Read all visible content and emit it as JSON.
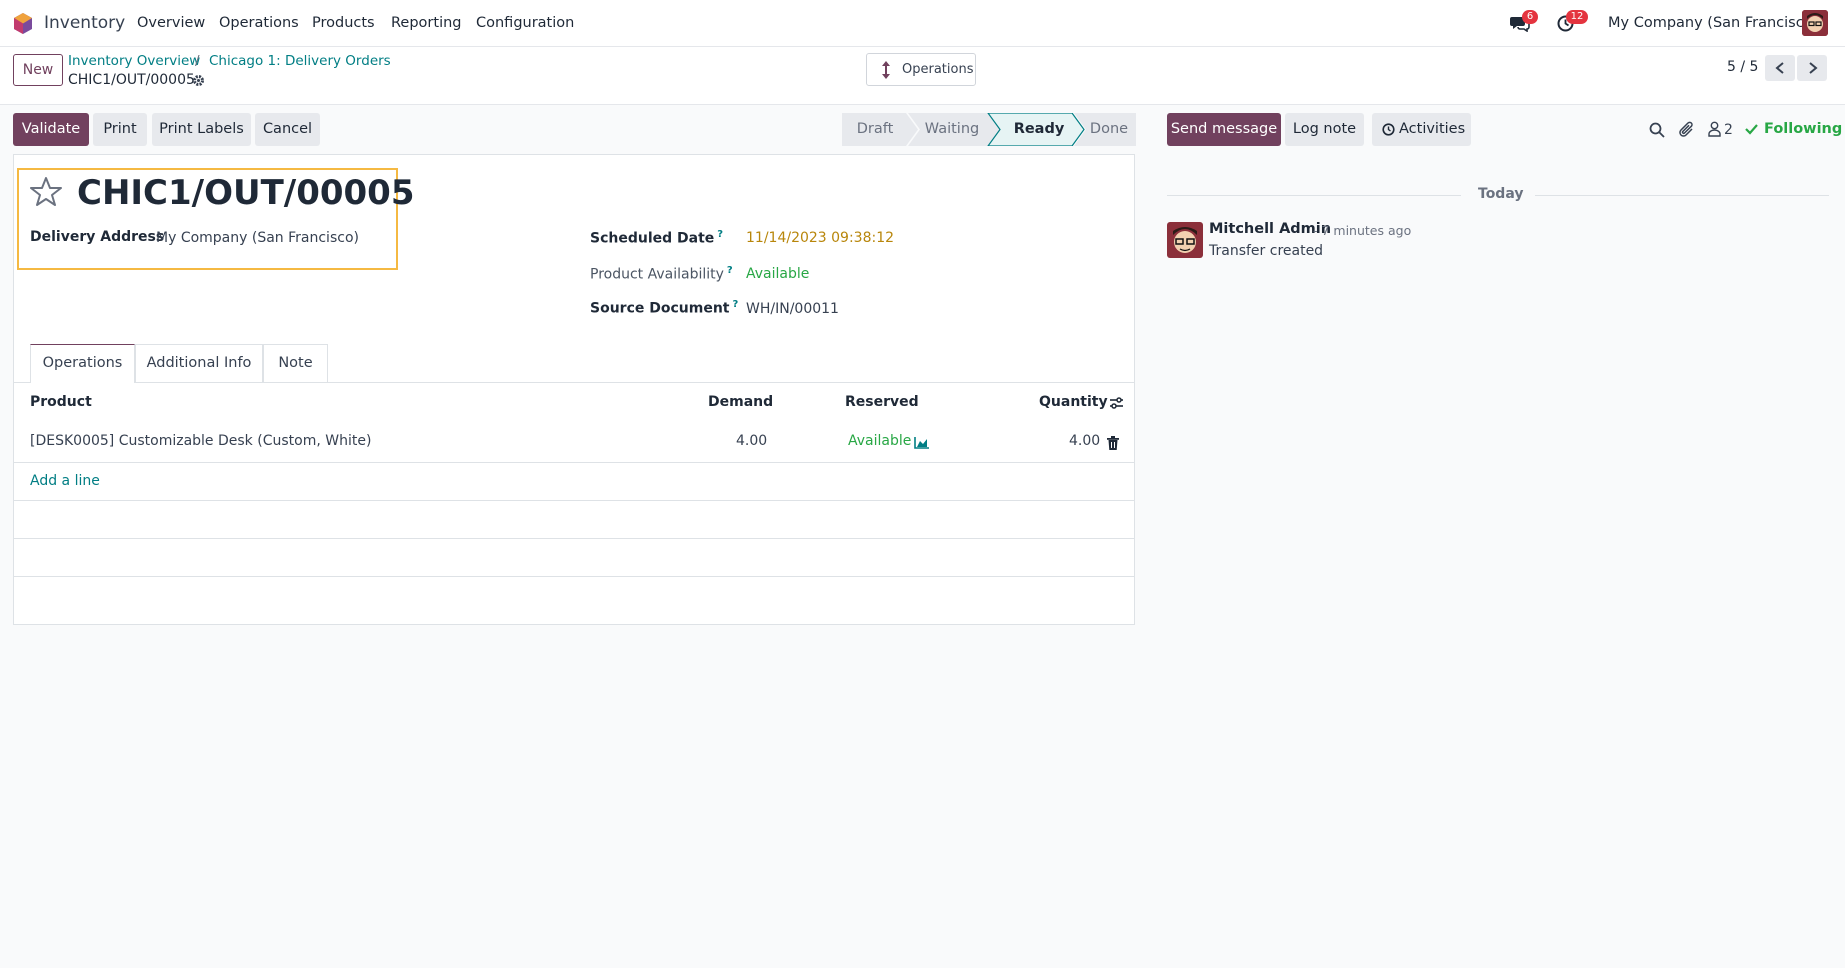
{
  "navbar": {
    "app_name": "Inventory",
    "menu": [
      "Overview",
      "Operations",
      "Products",
      "Reporting",
      "Configuration"
    ],
    "messages_count": "6",
    "activities_count": "12",
    "company": "My Company (San Francisco)"
  },
  "control": {
    "new_label": "New",
    "breadcrumbs": [
      "Inventory Overview",
      "Chicago 1: Delivery Orders"
    ],
    "separator": "/",
    "record_name": "CHIC1/OUT/00005",
    "operations_label": "Operations",
    "pager": "5 / 5"
  },
  "actions": {
    "validate": "Validate",
    "print": "Print",
    "print_labels": "Print Labels",
    "cancel": "Cancel"
  },
  "status": {
    "steps": [
      "Draft",
      "Waiting",
      "Ready",
      "Done"
    ],
    "current": "Ready"
  },
  "form": {
    "title": "CHIC1/OUT/00005",
    "delivery_address_label": "Delivery Address",
    "delivery_address": "My Company (San Francisco)",
    "scheduled_date_label": "Scheduled Date",
    "scheduled_date": "11/14/2023 09:38:12",
    "availability_label": "Product Availability",
    "availability": "Available",
    "source_label": "Source Document",
    "source": "WH/IN/00011",
    "help_mark": "?",
    "tabs": [
      "Operations",
      "Additional Info",
      "Note"
    ],
    "columns": {
      "product": "Product",
      "demand": "Demand",
      "reserved": "Reserved",
      "quantity": "Quantity"
    },
    "lines": [
      {
        "product": "[DESK0005] Customizable Desk (Custom, White)",
        "demand": "4.00",
        "reserved": "Available",
        "quantity": "4.00"
      }
    ],
    "add_line": "Add a line"
  },
  "chatter": {
    "send_message": "Send message",
    "log_note": "Log note",
    "activities": "Activities",
    "followers_count": "2",
    "following": "Following",
    "date_separator": "Today",
    "messages": [
      {
        "author": "Mitchell Admin",
        "time": "- 7 minutes ago",
        "body": "Transfer created"
      }
    ]
  },
  "colors": {
    "primary": "#71415e",
    "teal": "#017e84",
    "success": "#28a745",
    "warning": "#b8860b",
    "highlight": "#f5b942"
  }
}
